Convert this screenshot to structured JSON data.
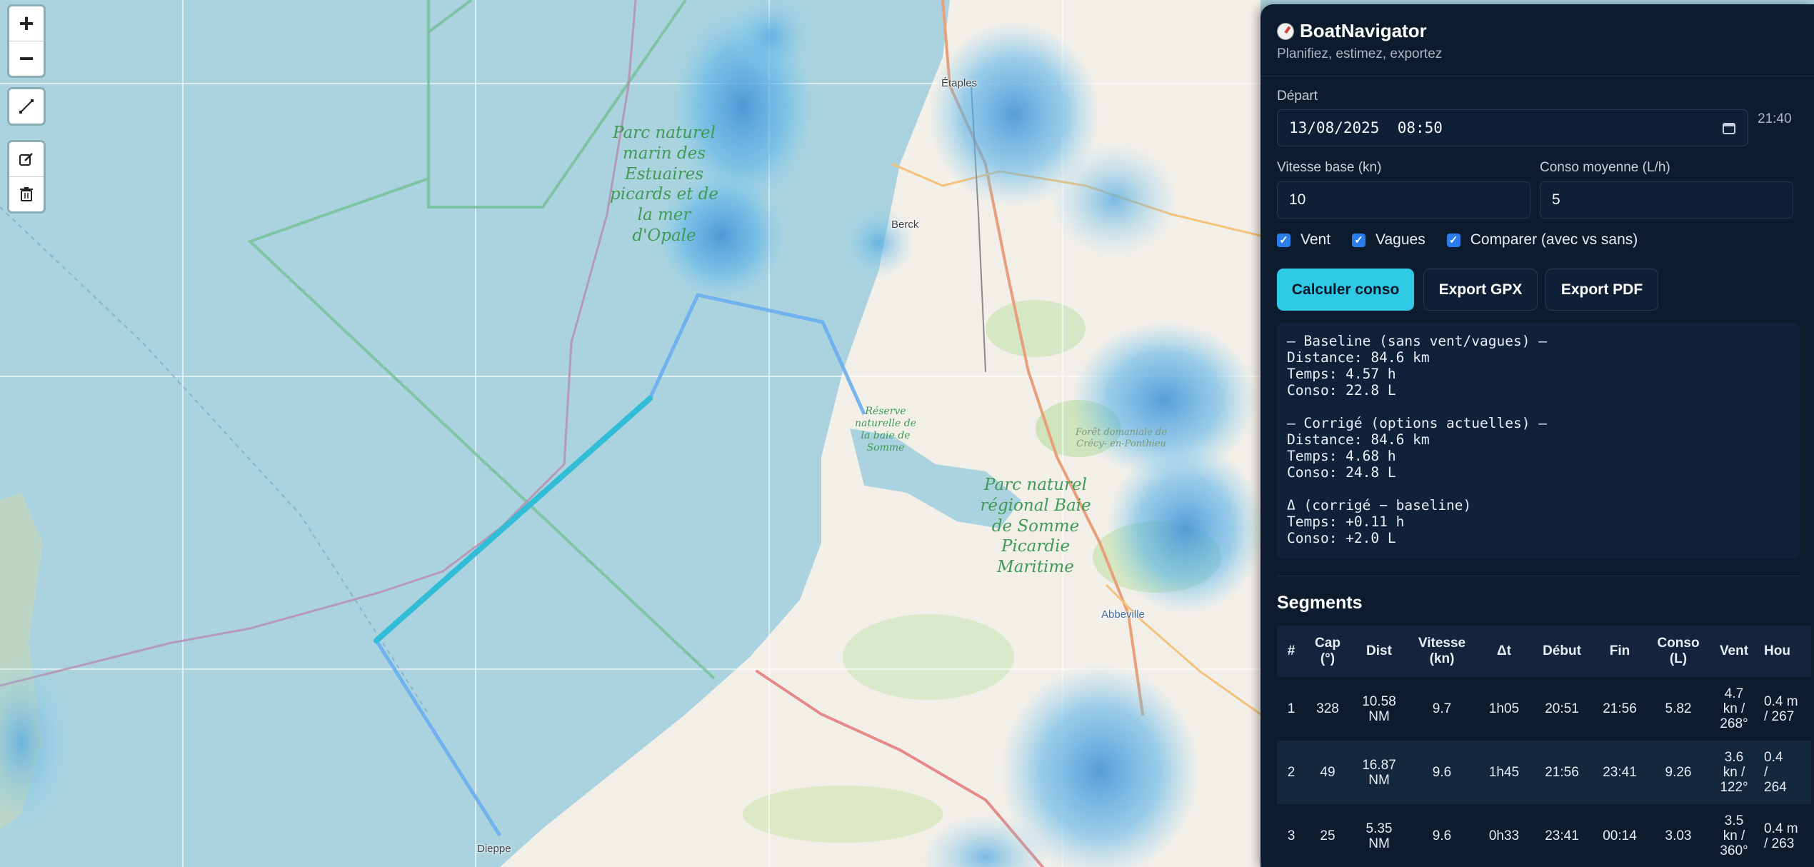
{
  "app": {
    "title": "BoatNavigator",
    "subtitle": "Planifiez, estimez, exportez"
  },
  "form": {
    "depart_label": "Départ",
    "depart_value": "13/08/2025  08:50",
    "time_badge": "21:40",
    "speed_label": "Vitesse base (kn)",
    "speed_value": "10",
    "conso_label": "Conso moyenne (L/h)",
    "conso_value": "5"
  },
  "options": [
    {
      "label": "Vent",
      "checked": true
    },
    {
      "label": "Vagues",
      "checked": true
    },
    {
      "label": "Comparer (avec vs sans)",
      "checked": true
    }
  ],
  "buttons": {
    "compute": "Calculer conso",
    "export_gpx": "Export GPX",
    "export_pdf": "Export PDF"
  },
  "results": {
    "lines": [
      "— Baseline (sans vent/vagues) —",
      "Distance: 84.6 km",
      "Temps: 4.57 h",
      "Conso: 22.8 L",
      "",
      "— Corrigé (options actuelles) —",
      "Distance: 84.6 km",
      "Temps: 4.68 h",
      "Conso: 24.8 L",
      "",
      "Δ (corrigé − baseline)",
      "Temps: +0.11 h",
      "Conso: +2.0 L"
    ]
  },
  "segments": {
    "title": "Segments",
    "headers": [
      "#",
      "Cap\n(°)",
      "Dist",
      "Vitesse\n(kn)",
      "Δt",
      "Début",
      "Fin",
      "Conso\n(L)",
      "Vent",
      "Hou"
    ],
    "rows": [
      [
        "1",
        "328",
        "10.58\nNM",
        "9.7",
        "1h05",
        "20:51",
        "21:56",
        "5.82",
        "4.7\nkn /\n268°",
        "0.4 m\n/ 267"
      ],
      [
        "2",
        "49",
        "16.87\nNM",
        "9.6",
        "1h45",
        "21:56",
        "23:41",
        "9.26",
        "3.6\nkn /\n122°",
        "0.4\n/\n264"
      ],
      [
        "3",
        "25",
        "5.35\nNM",
        "9.6",
        "0h33",
        "23:41",
        "00:14",
        "3.03",
        "3.5\nkn /\n360°",
        "0.4 m\n/ 263"
      ]
    ]
  },
  "map": {
    "zoom_in": "+",
    "zoom_out": "−",
    "places": {
      "etaples": "Étaples",
      "berck": "Berck",
      "dieppe": "Dieppe",
      "abbeville": "Abbeville"
    },
    "areas": {
      "parc_marin": "Parc naturel\nmarin des\nEstuaires\npicards\net de la\nmer d'Opale",
      "reserve": "Réserve\nnaturelle\nde la baie\nde Somme",
      "parc_regional": "Parc naturel\nrégional\nBaie de\nSomme\nPicardie\nMaritime",
      "foret": "Forêt domaniale\nde Crécy-\nen-Ponthieu"
    },
    "colors": {
      "sea": "#aad3df",
      "land": "#f2efe9",
      "route": "#6aaef0",
      "active_segment": "#31bcd8",
      "protected_area": "#6cbd8a"
    }
  }
}
